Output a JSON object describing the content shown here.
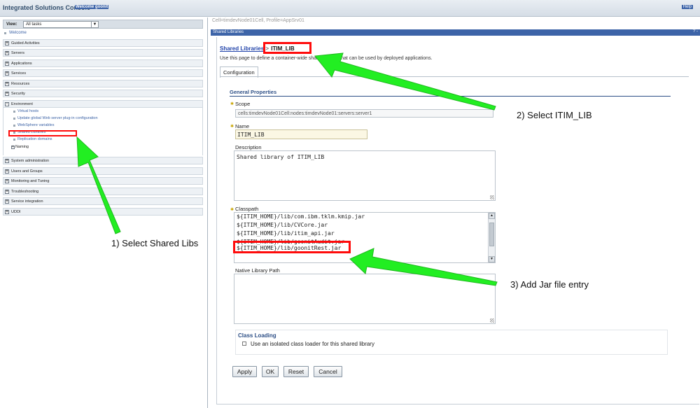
{
  "banner": {
    "title": "Integrated Solutions Console",
    "welcome": "Welcome goonit",
    "help": "Help"
  },
  "nav": {
    "view_label": "View:",
    "view_value": "All tasks",
    "welcome": "Welcome",
    "groups_top": [
      {
        "label": "Guided Activities",
        "toggle": "+"
      },
      {
        "label": "Servers",
        "toggle": "+"
      },
      {
        "label": "Applications",
        "toggle": "+"
      },
      {
        "label": "Services",
        "toggle": "+"
      },
      {
        "label": "Resources",
        "toggle": "+"
      },
      {
        "label": "Security",
        "toggle": "+"
      },
      {
        "label": "Environment",
        "toggle": "-"
      }
    ],
    "environment_items": [
      "Virtual hosts",
      "Update global Web server plug-in configuration",
      "WebSphere variables",
      "Shared Libraries",
      "Replication domains"
    ],
    "naming": {
      "label": "Naming",
      "toggle": "+"
    },
    "groups_bottom": [
      {
        "label": "System administration",
        "toggle": "+"
      },
      {
        "label": "Users and Groups",
        "toggle": "+"
      },
      {
        "label": "Monitoring and Tuning",
        "toggle": "+"
      },
      {
        "label": "Troubleshooting",
        "toggle": "+"
      },
      {
        "label": "Service integration",
        "toggle": "+"
      },
      {
        "label": "UDDI",
        "toggle": "+"
      }
    ]
  },
  "content": {
    "context": "Cell=timdevNode01Cell, Profile=AppSrv01",
    "portlet_title": "Shared Libraries",
    "portlet_controls": "? -",
    "breadcrumb_link": "Shared Libraries",
    "breadcrumb_sep": ">",
    "breadcrumb_current": "ITIM_LIB",
    "description": "Use this page to define a container-wide shared library that can be used by deployed applications.",
    "tab": "Configuration",
    "section_title": "General Properties",
    "scope_label": "Scope",
    "scope_value": "cells:timdevNode01Cell:nodes:timdevNode01:servers:server1",
    "name_label": "Name",
    "name_value": "ITIM_LIB",
    "description_label": "Description",
    "description_value": "Shared library of ITIM_LIB",
    "classpath_label": "Classpath",
    "classpath": [
      "${ITIM_HOME}/lib/com.ibm.tklm.kmip.jar",
      "${ITIM_HOME}/lib/CVCore.jar",
      "${ITIM_HOME}/lib/itim_api.jar",
      "${ITIM_HOME}/lib/goonitAudit.jar",
      "${ITIM_HOME}/lib/goonitRest.jar"
    ],
    "native_label": "Native Library Path",
    "native_value": "",
    "class_loading_title": "Class Loading",
    "isolated_label": "Use an isolated class loader for this shared library",
    "isolated_checked": false,
    "buttons": {
      "apply": "Apply",
      "ok": "OK",
      "reset": "Reset",
      "cancel": "Cancel"
    }
  },
  "annotations": {
    "step1": "1) Select Shared Libs",
    "step2": "2) Select ITIM_LIB",
    "step3": "3) Add Jar file entry",
    "highlight_color": "#ff0b0b",
    "arrow_color": "#22ee22"
  }
}
